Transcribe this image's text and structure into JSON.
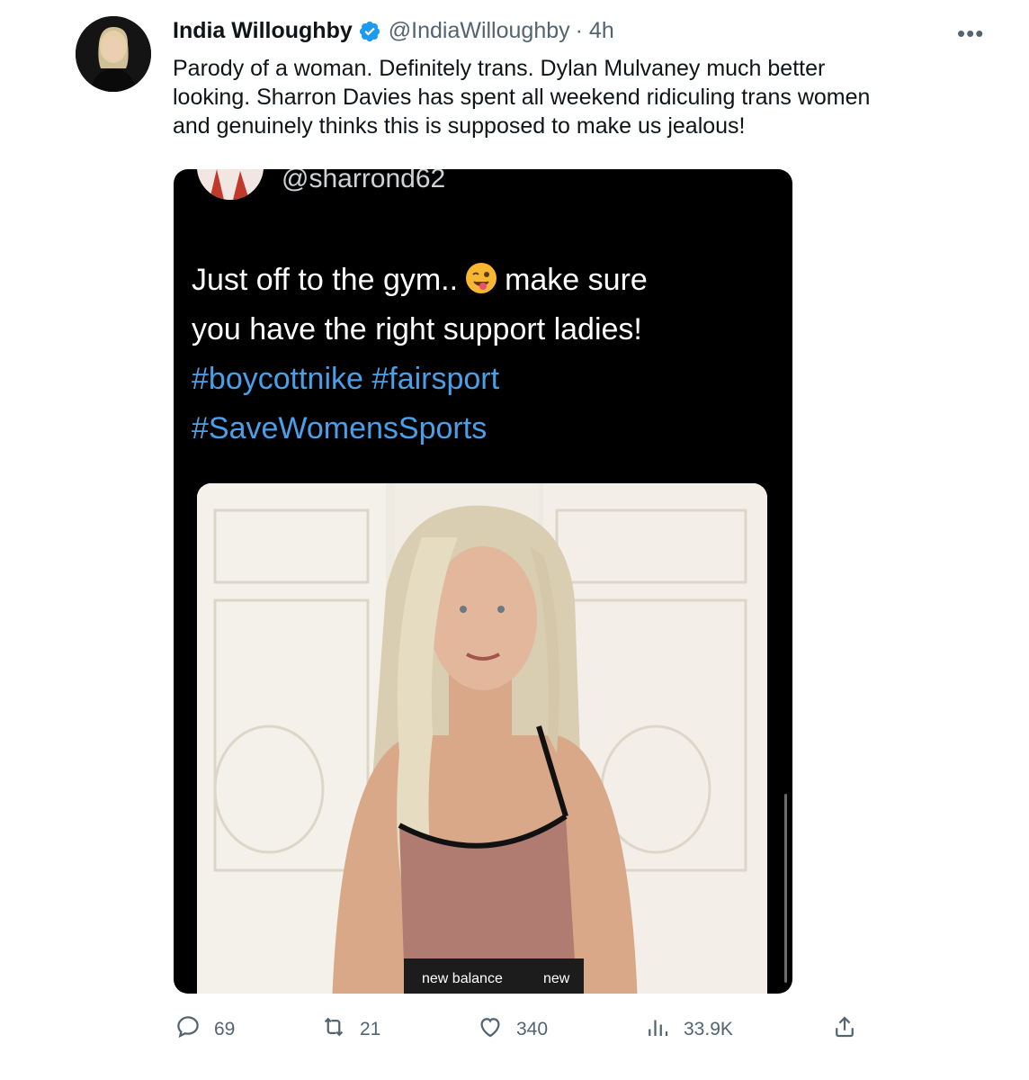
{
  "tweet": {
    "author_name": "India Willoughby",
    "author_handle": "@IndiaWilloughby",
    "timestamp": "· 4h",
    "text_lines": [
      "Parody of a woman. Definitely trans. Dylan Mulvaney much better",
      "looking. Sharron Davies has spent all weekend ridiculing trans women",
      "and genuinely thinks this is supposed to make us jealous!"
    ]
  },
  "embedded": {
    "handle": "@sharrond62",
    "line1_a": "Just off to the gym..",
    "line1_b": "make sure",
    "line2": "you have the right support ladies!",
    "hashtags_line1": "#boycottnike #fairsport",
    "hashtags_line2": "#SaveWomensSports",
    "photo_brand": "new balance",
    "photo_brand_2": "new"
  },
  "actions": {
    "replies": "69",
    "retweets": "21",
    "likes": "340",
    "views": "33.9K"
  },
  "colors": {
    "verified_blue": "#1d9bf0",
    "hashtag_blue": "#4aa0e8",
    "muted_gray": "#536471"
  },
  "icons": [
    "more-icon",
    "verified-icon",
    "wink-emoji-icon",
    "reply-icon",
    "retweet-icon",
    "like-icon",
    "views-icon",
    "share-icon"
  ]
}
